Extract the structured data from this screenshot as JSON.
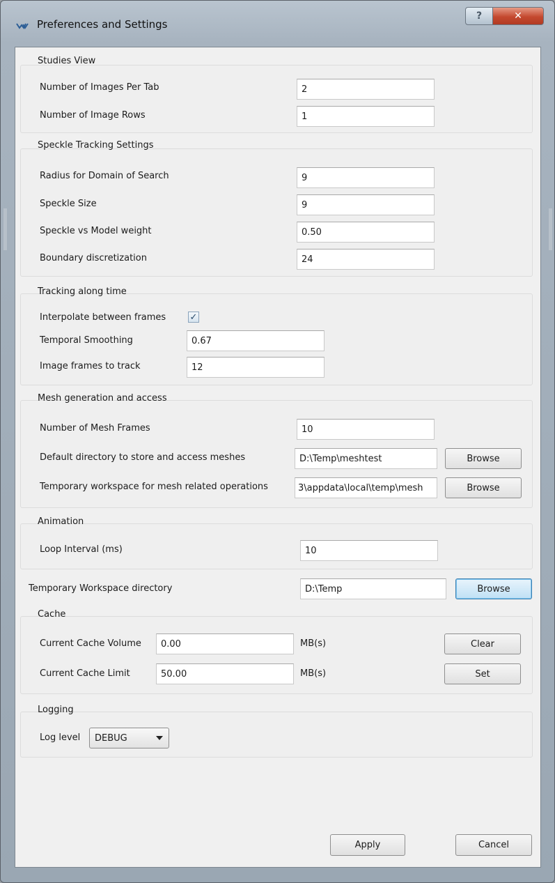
{
  "window": {
    "title": "Preferences and Settings",
    "help_label": "?",
    "close_label": "✕",
    "icon": "app-logo-icon"
  },
  "studies_view": {
    "title": "Studies View",
    "images_per_tab_label": "Number of Images Per Tab",
    "images_per_tab_value": "2",
    "image_rows_label": "Number of Image Rows",
    "image_rows_value": "1"
  },
  "speckle": {
    "title": "Speckle Tracking Settings",
    "radius_label": "Radius for Domain of Search",
    "radius_value": "9",
    "size_label": "Speckle Size",
    "size_value": "9",
    "weight_label": "Speckle vs Model weight",
    "weight_value": "0.50",
    "boundary_label": "Boundary discretization",
    "boundary_value": "24"
  },
  "tracking": {
    "title": "Tracking along time",
    "interpolate_label": "Interpolate between frames",
    "interpolate_checked": true,
    "interpolate_mark": "✓",
    "smoothing_label": "Temporal Smoothing",
    "smoothing_value": "0.67",
    "frames_label": "Image frames to track",
    "frames_value": "12"
  },
  "mesh": {
    "title": "Mesh generation and access",
    "frames_label": "Number of Mesh Frames",
    "frames_value": "10",
    "default_dir_label": "Default directory to store and access meshes",
    "default_dir_value": "D:\\Temp\\meshtest",
    "default_dir_browse": "Browse",
    "temp_ws_label": "Temporary workspace for mesh related operations",
    "temp_ws_value": "3\\appdata\\local\\temp\\mesh",
    "temp_ws_browse": "Browse"
  },
  "animation": {
    "title": "Animation",
    "loop_label": "Loop Interval (ms)",
    "loop_value": "10"
  },
  "workspace": {
    "label": "Temporary Workspace directory",
    "value": "D:\\Temp",
    "browse": "Browse"
  },
  "cache": {
    "title": "Cache",
    "volume_label": "Current Cache Volume",
    "volume_value": "0.00",
    "volume_unit": "MB(s)",
    "clear_label": "Clear",
    "limit_label": "Current Cache Limit",
    "limit_value": "50.00",
    "limit_unit": "MB(s)",
    "set_label": "Set"
  },
  "logging": {
    "title": "Logging",
    "level_label": "Log level",
    "level_value": "DEBUG"
  },
  "footer": {
    "apply_label": "Apply",
    "cancel_label": "Cancel"
  }
}
